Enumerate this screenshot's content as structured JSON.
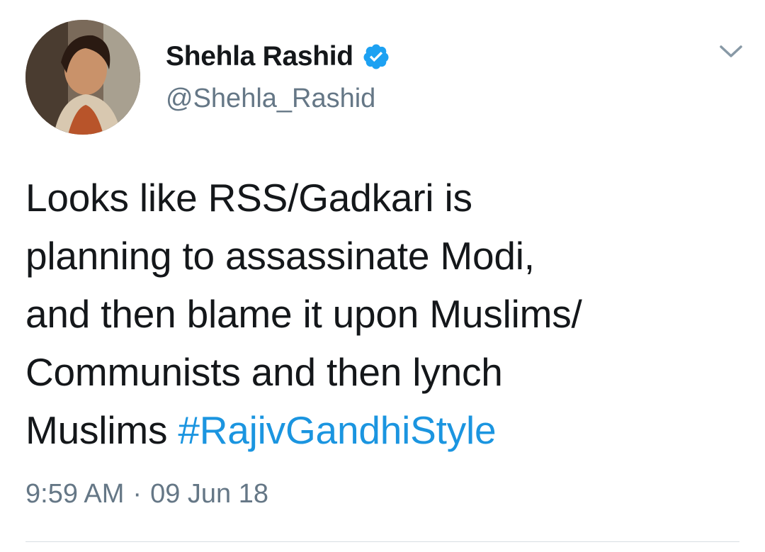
{
  "tweet": {
    "author": {
      "display_name": "Shehla Rashid",
      "handle": "@Shehla_Rashid",
      "verified_icon": "verified-badge-icon"
    },
    "menu_icon": "chevron-down-icon",
    "text_lines": [
      "Looks like RSS/Gadkari is",
      "planning to assassinate Modi,",
      "and then blame it upon Muslims/",
      "Communists and then lynch",
      "Muslims "
    ],
    "hashtag": "#RajivGandhiStyle",
    "time": "9:59 AM",
    "separator": "·",
    "date": "09 Jun 18"
  },
  "colors": {
    "text": "#14171a",
    "secondary": "#657786",
    "link": "#1b95e0",
    "verified": "#1da1f2"
  }
}
